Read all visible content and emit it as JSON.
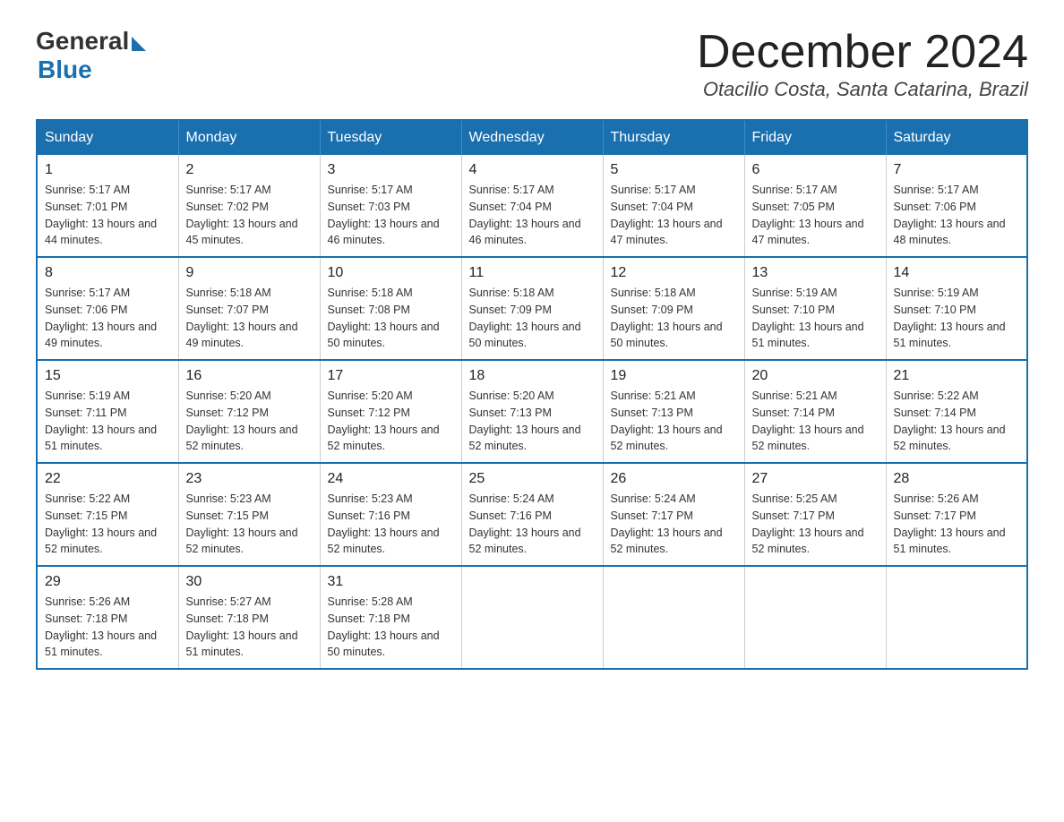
{
  "header": {
    "logo_general": "General",
    "logo_blue": "Blue",
    "month_title": "December 2024",
    "location": "Otacilio Costa, Santa Catarina, Brazil"
  },
  "calendar": {
    "days_of_week": [
      "Sunday",
      "Monday",
      "Tuesday",
      "Wednesday",
      "Thursday",
      "Friday",
      "Saturday"
    ],
    "weeks": [
      [
        {
          "day": "1",
          "sunrise": "5:17 AM",
          "sunset": "7:01 PM",
          "daylight": "13 hours and 44 minutes."
        },
        {
          "day": "2",
          "sunrise": "5:17 AM",
          "sunset": "7:02 PM",
          "daylight": "13 hours and 45 minutes."
        },
        {
          "day": "3",
          "sunrise": "5:17 AM",
          "sunset": "7:03 PM",
          "daylight": "13 hours and 46 minutes."
        },
        {
          "day": "4",
          "sunrise": "5:17 AM",
          "sunset": "7:04 PM",
          "daylight": "13 hours and 46 minutes."
        },
        {
          "day": "5",
          "sunrise": "5:17 AM",
          "sunset": "7:04 PM",
          "daylight": "13 hours and 47 minutes."
        },
        {
          "day": "6",
          "sunrise": "5:17 AM",
          "sunset": "7:05 PM",
          "daylight": "13 hours and 47 minutes."
        },
        {
          "day": "7",
          "sunrise": "5:17 AM",
          "sunset": "7:06 PM",
          "daylight": "13 hours and 48 minutes."
        }
      ],
      [
        {
          "day": "8",
          "sunrise": "5:17 AM",
          "sunset": "7:06 PM",
          "daylight": "13 hours and 49 minutes."
        },
        {
          "day": "9",
          "sunrise": "5:18 AM",
          "sunset": "7:07 PM",
          "daylight": "13 hours and 49 minutes."
        },
        {
          "day": "10",
          "sunrise": "5:18 AM",
          "sunset": "7:08 PM",
          "daylight": "13 hours and 50 minutes."
        },
        {
          "day": "11",
          "sunrise": "5:18 AM",
          "sunset": "7:09 PM",
          "daylight": "13 hours and 50 minutes."
        },
        {
          "day": "12",
          "sunrise": "5:18 AM",
          "sunset": "7:09 PM",
          "daylight": "13 hours and 50 minutes."
        },
        {
          "day": "13",
          "sunrise": "5:19 AM",
          "sunset": "7:10 PM",
          "daylight": "13 hours and 51 minutes."
        },
        {
          "day": "14",
          "sunrise": "5:19 AM",
          "sunset": "7:10 PM",
          "daylight": "13 hours and 51 minutes."
        }
      ],
      [
        {
          "day": "15",
          "sunrise": "5:19 AM",
          "sunset": "7:11 PM",
          "daylight": "13 hours and 51 minutes."
        },
        {
          "day": "16",
          "sunrise": "5:20 AM",
          "sunset": "7:12 PM",
          "daylight": "13 hours and 52 minutes."
        },
        {
          "day": "17",
          "sunrise": "5:20 AM",
          "sunset": "7:12 PM",
          "daylight": "13 hours and 52 minutes."
        },
        {
          "day": "18",
          "sunrise": "5:20 AM",
          "sunset": "7:13 PM",
          "daylight": "13 hours and 52 minutes."
        },
        {
          "day": "19",
          "sunrise": "5:21 AM",
          "sunset": "7:13 PM",
          "daylight": "13 hours and 52 minutes."
        },
        {
          "day": "20",
          "sunrise": "5:21 AM",
          "sunset": "7:14 PM",
          "daylight": "13 hours and 52 minutes."
        },
        {
          "day": "21",
          "sunrise": "5:22 AM",
          "sunset": "7:14 PM",
          "daylight": "13 hours and 52 minutes."
        }
      ],
      [
        {
          "day": "22",
          "sunrise": "5:22 AM",
          "sunset": "7:15 PM",
          "daylight": "13 hours and 52 minutes."
        },
        {
          "day": "23",
          "sunrise": "5:23 AM",
          "sunset": "7:15 PM",
          "daylight": "13 hours and 52 minutes."
        },
        {
          "day": "24",
          "sunrise": "5:23 AM",
          "sunset": "7:16 PM",
          "daylight": "13 hours and 52 minutes."
        },
        {
          "day": "25",
          "sunrise": "5:24 AM",
          "sunset": "7:16 PM",
          "daylight": "13 hours and 52 minutes."
        },
        {
          "day": "26",
          "sunrise": "5:24 AM",
          "sunset": "7:17 PM",
          "daylight": "13 hours and 52 minutes."
        },
        {
          "day": "27",
          "sunrise": "5:25 AM",
          "sunset": "7:17 PM",
          "daylight": "13 hours and 52 minutes."
        },
        {
          "day": "28",
          "sunrise": "5:26 AM",
          "sunset": "7:17 PM",
          "daylight": "13 hours and 51 minutes."
        }
      ],
      [
        {
          "day": "29",
          "sunrise": "5:26 AM",
          "sunset": "7:18 PM",
          "daylight": "13 hours and 51 minutes."
        },
        {
          "day": "30",
          "sunrise": "5:27 AM",
          "sunset": "7:18 PM",
          "daylight": "13 hours and 51 minutes."
        },
        {
          "day": "31",
          "sunrise": "5:28 AM",
          "sunset": "7:18 PM",
          "daylight": "13 hours and 50 minutes."
        },
        null,
        null,
        null,
        null
      ]
    ]
  }
}
